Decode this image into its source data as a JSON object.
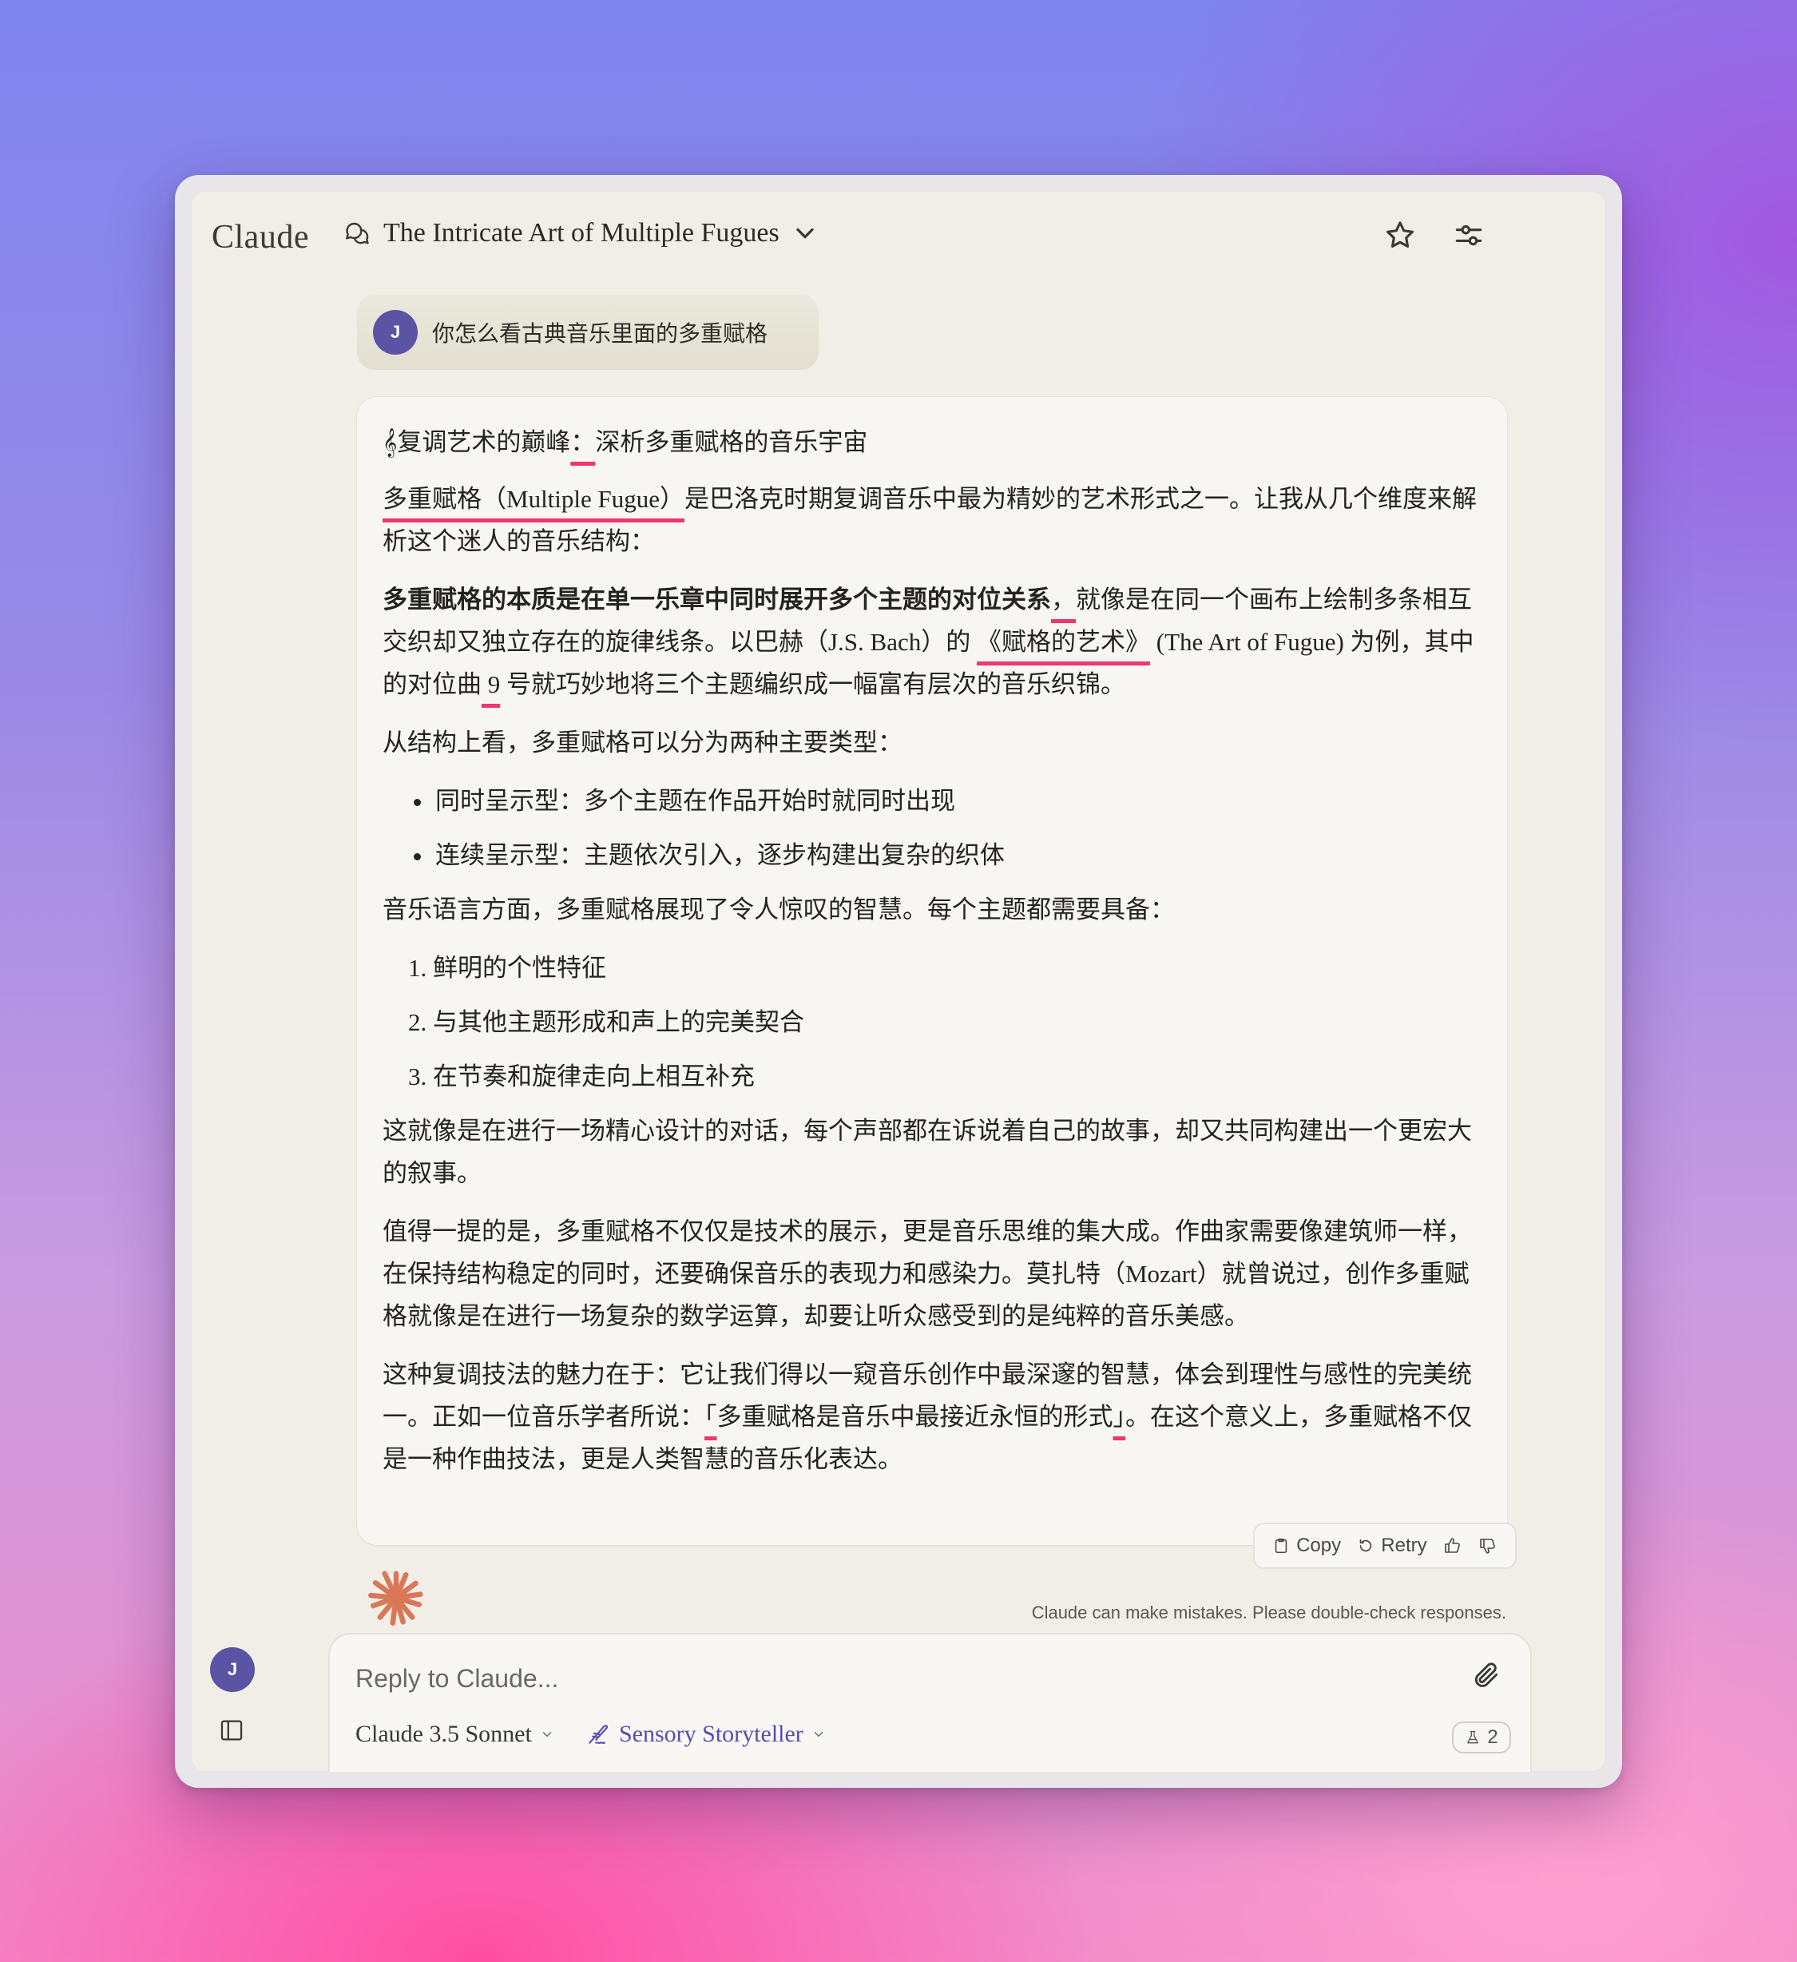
{
  "app": {
    "logo": "Claude"
  },
  "header": {
    "chat_title": "The Intricate Art of Multiple Fugues",
    "icons": [
      "chat-bubbles-icon",
      "chevron-down-icon",
      "star-icon",
      "sliders-icon"
    ]
  },
  "user": {
    "initial": "J",
    "message": "你怎么看古典音乐里面的多重赋格"
  },
  "assistant": {
    "heading_icon": "𝄞",
    "heading_a": "复调艺术的巅峰",
    "heading_colon": "：",
    "heading_b": "深析多重赋格的音乐宇宙",
    "p1_mark": "多重赋格（Multiple Fugue）",
    "p1_rest": "是巴洛克时期复调音乐中最为精妙的艺术形式之一。让我从几个维度来解析这个迷人的音乐结构：",
    "p2_bold": "多重赋格的本质是在单一乐章中同时展开多个主题的对位关系",
    "p2_comma": "，",
    "p2_a": "就像是在同一个画布上绘制多条相互交织却又独立存在的旋律线条。以巴赫（J.S. Bach）的 ",
    "p2_mark": "《赋格的艺术》",
    "p2_b": " (The Art of Fugue) 为例，其中的对位曲",
    "p2_num": " 9",
    "p2_c": " 号就巧妙地将三个主题编织成一幅富有层次的音乐织锦。",
    "p3": "从结构上看，多重赋格可以分为两种主要类型：",
    "bullets": [
      "同时呈示型：多个主题在作品开始时就同时出现",
      "连续呈示型：主题依次引入，逐步构建出复杂的织体"
    ],
    "p4": "音乐语言方面，多重赋格展现了令人惊叹的智慧。每个主题都需要具备：",
    "numbered": [
      "1. 鲜明的个性特征",
      "2. 与其他主题形成和声上的完美契合",
      "3. 在节奏和旋律走向上相互补充"
    ],
    "p5": "这就像是在进行一场精心设计的对话，每个声部都在诉说着自己的故事，却又共同构建出一个更宏大的叙事。",
    "p6": "值得一提的是，多重赋格不仅仅是技术的展示，更是音乐思维的集大成。作曲家需要像建筑师一样，在保持结构稳定的同时，还要确保音乐的表现力和感染力。莫扎特（Mozart）就曾说过，创作多重赋格就像是在进行一场复杂的数学运算，却要让听众感受到的是纯粹的音乐美感。",
    "p7_a": "这种复调技法的魅力在于：它让我们得以一窥音乐创作中最深邃的智慧，体会到理性与感性的完美统一。正如一位音乐学者所说：",
    "p7_open": "「",
    "p7_quote": "多重赋格是音乐中最接近永恒的形式",
    "p7_close": "」",
    "p7_b": "。在这个意义上，多重赋格不仅是一种作曲技法，更是人类智慧的音乐化表达。",
    "highlight_color": "#f0356f"
  },
  "actions": {
    "copy": "Copy",
    "retry": "Retry"
  },
  "disclaimer": "Claude can make mistakes. Please double-check responses.",
  "composer": {
    "placeholder": "Reply to Claude...",
    "model": "Claude 3.5 Sonnet",
    "style": "Sensory Storyteller",
    "lab_count": "2"
  },
  "colors": {
    "accent": "#564cb0",
    "avatar": "#5b53a3",
    "spark": "#d97757"
  }
}
